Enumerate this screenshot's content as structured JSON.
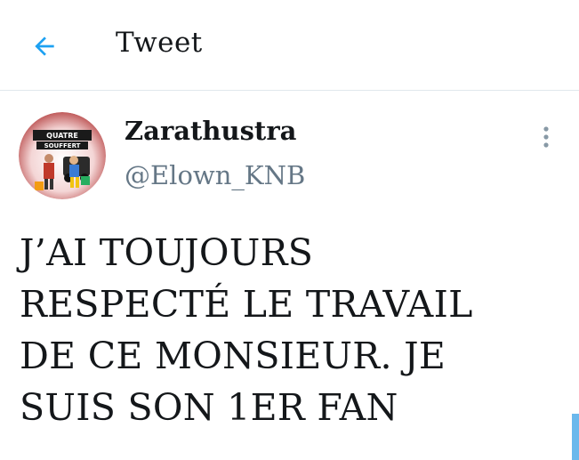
{
  "header": {
    "back_icon": "back-arrow-icon",
    "title": "Tweet"
  },
  "tweet": {
    "author": {
      "name": "Zarathustra",
      "handle": "@Elown_KNB",
      "avatar_text_top": "QUATRE",
      "avatar_text_bottom": "SOUFFERT"
    },
    "more_icon": "more-vertical-icon",
    "text_lines": [
      "J’AI TOUJOURS",
      "RESPECTÉ LE TRAVAIL",
      "DE CE MONSIEUR. JE",
      "SUIS SON 1ER FAN"
    ]
  },
  "colors": {
    "accent": "#1da1f2",
    "text": "#14171a",
    "secondary": "#657786",
    "divider": "#e1e8ed"
  }
}
